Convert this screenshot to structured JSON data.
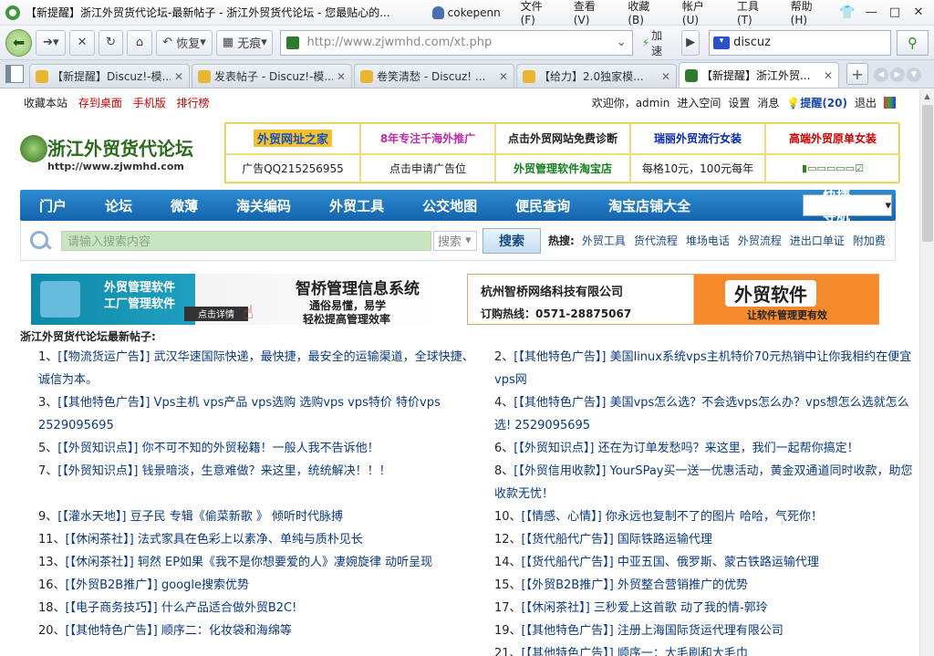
{
  "window": {
    "title": "【新提醒】浙江外贸货代论坛-最新帖子 - 浙江外贸货代论坛 - 您最贴心的...",
    "user": "cokepenn",
    "menu": [
      "文件(F)",
      "查看(V)",
      "收藏(B)",
      "帐户(U)",
      "工具(T)",
      "帮助(H)"
    ],
    "buttons": {
      "min": "—",
      "max": "□",
      "close": "✕"
    }
  },
  "toolbar": {
    "restore_label": "恢复",
    "nomark_label": "无痕",
    "url": "http://www.zjwmhd.com/xt.php",
    "speed_label": "加速",
    "search_value": "discuz"
  },
  "tabs": [
    {
      "label": "【新提醒】Discuz!-模...",
      "active": false
    },
    {
      "label": "发表帖子 - Discuz!-模...",
      "active": false
    },
    {
      "label": "卷笑清愁 - Discuz! ...",
      "active": false
    },
    {
      "label": "【给力】2.0独家模...",
      "active": false
    },
    {
      "label": "【新提醒】浙江外贸...",
      "active": true
    }
  ],
  "topline": {
    "left": [
      "收藏本站",
      "存到桌面",
      "手机版",
      "排行榜"
    ],
    "welcome": "欢迎你，",
    "username": "admin",
    "links": [
      "进入空间",
      "设置",
      "消息"
    ],
    "remind": "提醒(20)",
    "logout": "退出"
  },
  "logo": {
    "name": "浙江外贸货代论坛",
    "url": "http://www.zjwmhd.com"
  },
  "ads": [
    "外贸网址之家",
    "8年专注千海外推广",
    "点击外贸网站免费诊断",
    "瑞丽外贸流行女装",
    "高端外贸原单女装",
    "广告QQ215256955",
    "点击申请广告位",
    "外贸管理软件淘宝店",
    "每格10元，100元每年",
    ""
  ],
  "mainnav": {
    "items": [
      "门户",
      "论坛",
      "微薄",
      "海关编码",
      "外贸工具",
      "公交地图",
      "便民查询",
      "淘宝店铺大全"
    ],
    "quick": "快捷导航"
  },
  "search": {
    "placeholder": "请输入搜索内容",
    "type": "搜索",
    "button": "搜索",
    "hot_label": "热搜:",
    "hot": [
      "外贸工具",
      "货代流程",
      "堆场电话",
      "外贸流程",
      "进出口单证",
      "附加费"
    ]
  },
  "banners": {
    "b1": [
      "外贸管理软件",
      "工厂管理软件",
      "智桥管理信息系统",
      "通俗易懂，易学",
      "轻松提高管理效率",
      "点击详情"
    ],
    "b2": [
      "杭州智桥网络科技有限公司",
      "订购热线：0571-28875067",
      "外贸软件",
      "让软件管理更有效"
    ]
  },
  "section_title": "浙江外贸货代论坛最新帖子:",
  "posts": [
    {
      "n": "1、",
      "cat": "[【物流货运广告】]",
      "title": "武汉华速国际快递，最快捷，最安全的运输渠道，全球快捷、诚信为本。"
    },
    {
      "n": "2、",
      "cat": "[【其他特色广告】]",
      "title": "美国linux系统vps主机特价70元热销中让你我相约在便宜vps网"
    },
    {
      "n": "3、",
      "cat": "[【其他特色广告】]",
      "title": "Vps主机  vps产品  vps选购  选购vps vps特价  特价vps 2529095695"
    },
    {
      "n": "4、",
      "cat": "[【其他特色广告】]",
      "title": "美国vps怎么选？不会选vps怎么办？vps想怎么选就怎么选! 2529095695"
    },
    {
      "n": "5、",
      "cat": "[【外贸知识点】]",
      "title": "你不可不知的外贸秘籍！一般人我不告诉他！"
    },
    {
      "n": "6、",
      "cat": "[【外贸知识点】]",
      "title": "还在为订单发愁吗？来这里，我们一起帮你搞定！"
    },
    {
      "n": "7、",
      "cat": "[【外贸知识点】]",
      "title": "钱景暗淡，生意难做？来这里，统统解决！！！"
    },
    {
      "n": "8、",
      "cat": "[【外贸信用收款】]",
      "title": "YourSPay买一送一优惠活动，黄金双通道同时收款，助您收款无忧！"
    },
    {
      "n": "9、",
      "cat": "[【灌水天地】]",
      "title": "豆子民  专辑《偷菜新歌 》  倾听时代脉搏"
    },
    {
      "n": "10、",
      "cat": "[【情感、心情】]",
      "title": "你永远也复制不了的图片 哈哈，气死你！"
    },
    {
      "n": "11、",
      "cat": "[【休闲茶社】]",
      "title": "法式家具在色彩上以素净、单纯与质朴见长"
    },
    {
      "n": "12、",
      "cat": "[【货代船代广告】]",
      "title": "国际铁路运输代理"
    },
    {
      "n": "13、",
      "cat": "[【休闲茶社】]",
      "title": "轲然  EP如果《我不是你想要爱的人》凄婉旋律  动听呈现"
    },
    {
      "n": "14、",
      "cat": "[【货代船代广告】]",
      "title": "中亚五国、俄罗斯、蒙古铁路运输代理"
    },
    {
      "n": "16、",
      "cat": "[【外贸B2B推广】]",
      "title": "google搜索优势"
    },
    {
      "n": "15、",
      "cat": "[【外贸B2B推广】]",
      "title": "外贸整合营销推广的优势"
    },
    {
      "n": "18、",
      "cat": "[【电子商务技巧】]",
      "title": "什么产品适合做外贸B2C!"
    },
    {
      "n": "17、",
      "cat": "[【休闲茶社】]",
      "title": "三秒爱上这首歌  动了我的情-郭玲"
    },
    {
      "n": "20、",
      "cat": "[【其他特色广告】]",
      "title": "顺序二：化妆袋和海绵等"
    },
    {
      "n": "19、",
      "cat": "[【其他特色广告】]",
      "title": "注册上海国际货运代理有限公司"
    },
    {
      "n": "",
      "cat": "",
      "title": ""
    },
    {
      "n": "21、",
      "cat": "[【其他特色广告】]",
      "title": "顺序一：大毛刷和大毛巾"
    }
  ]
}
